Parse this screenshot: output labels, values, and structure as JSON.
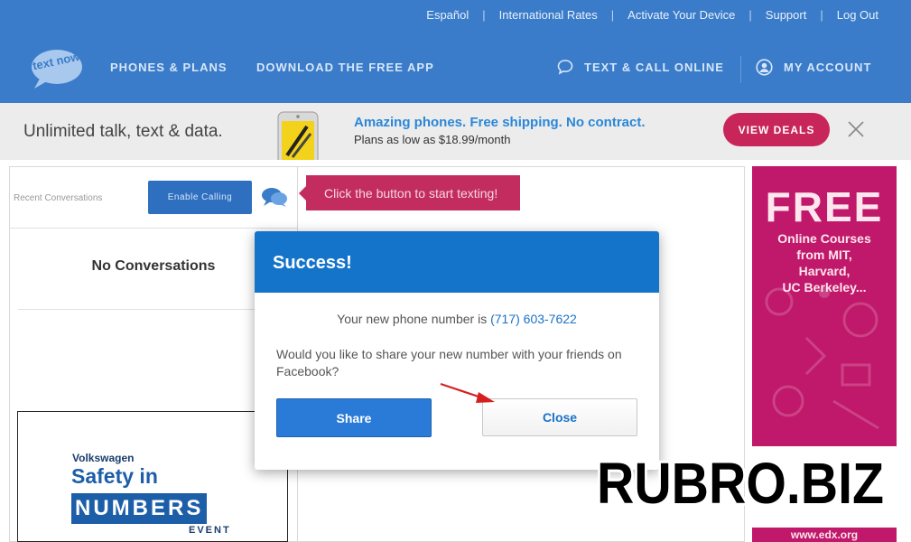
{
  "utility_links": [
    "Español",
    "International Rates",
    "Activate Your Device",
    "Support",
    "Log Out"
  ],
  "nav": {
    "logo_text": "text now",
    "phones_plans": "PHONES & PLANS",
    "download_app": "DOWNLOAD THE FREE APP",
    "text_call_online": "TEXT & CALL ONLINE",
    "my_account": "MY ACCOUNT"
  },
  "promo": {
    "tagline": "Unlimited talk, text & data.",
    "headline": "Amazing phones. Free shipping. No contract.",
    "subline": "Plans as low as $18.99/month",
    "cta": "VIEW DEALS"
  },
  "app": {
    "recent_label": "Recent Conversations",
    "enable_calling": "Enable Calling",
    "hint": "Click the button to start texting!",
    "no_conversations": "No Conversations"
  },
  "vw_ad": {
    "brand": "Volkswagen",
    "line2": "Safety in",
    "line3": "NUMBERS",
    "line4": "EVENT"
  },
  "side_ad": {
    "headline": "FREE",
    "lines": [
      "Online Courses",
      "from MIT,",
      "Harvard,",
      "UC Berkeley..."
    ],
    "url": "www.edx.org"
  },
  "modal": {
    "title": "Success!",
    "number_prefix": "Your new phone number is ",
    "number": "(717) 603-7622",
    "question": "Would you like to share your new number with your friends on Facebook?",
    "share": "Share",
    "close": "Close"
  },
  "watermark": "RUBRO.BIZ",
  "colors": {
    "brand_blue": "#3a7cc9",
    "modal_blue": "#1474c9",
    "accent_pink": "#c8255b"
  }
}
